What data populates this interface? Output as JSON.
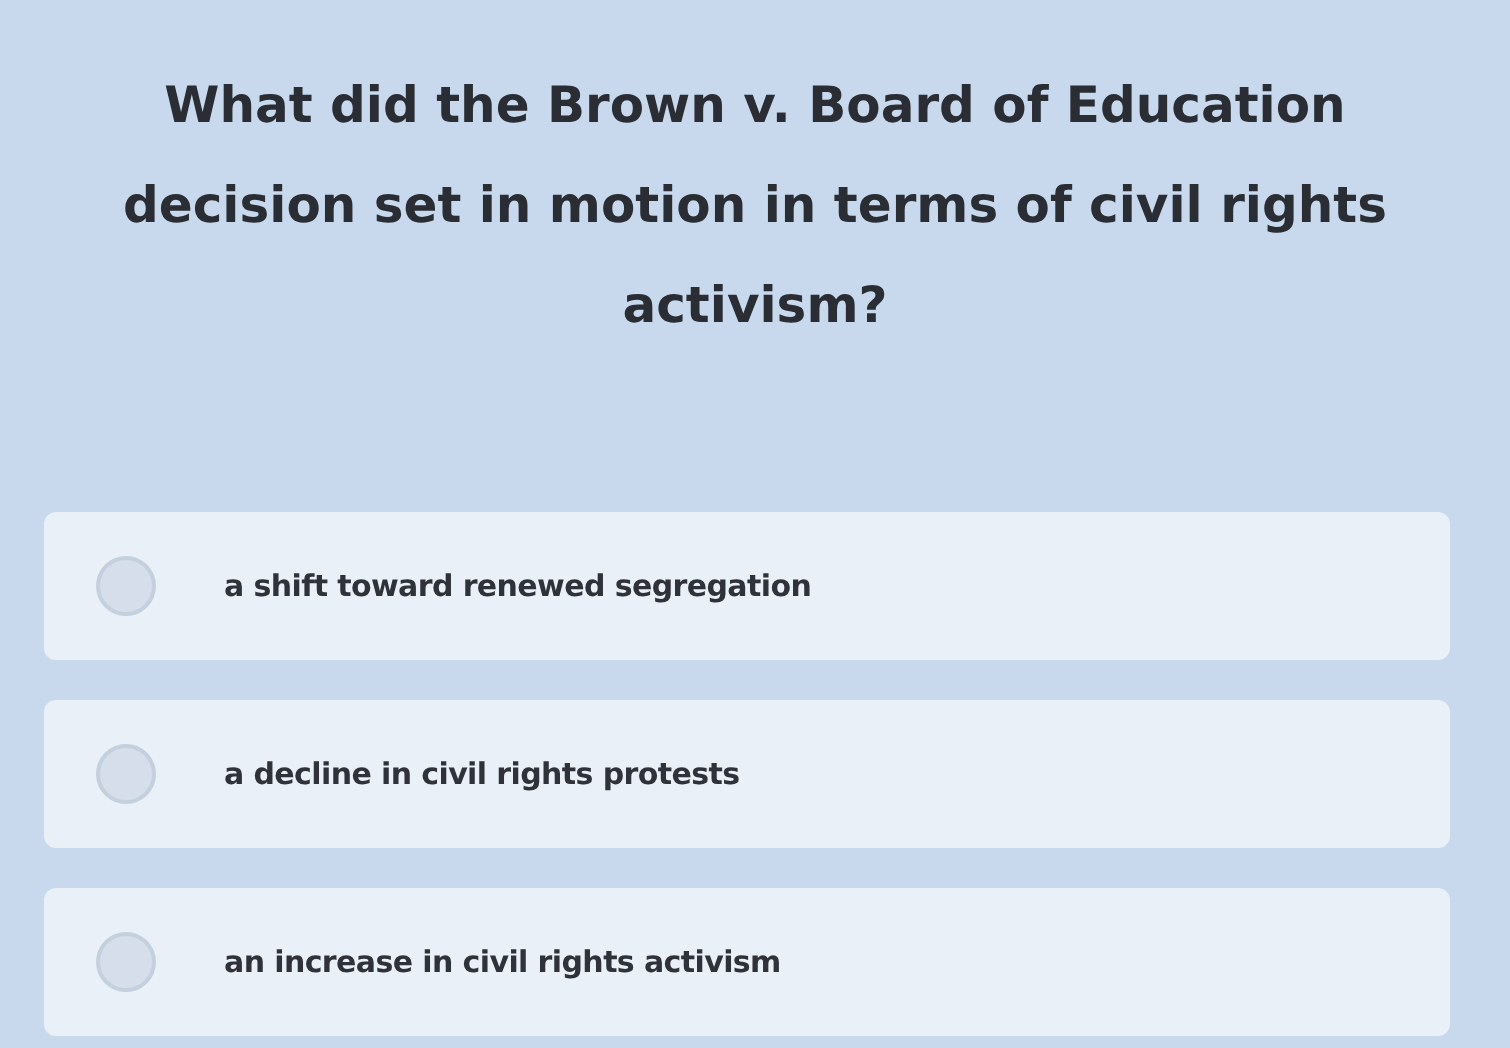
{
  "question": "What did the Brown v. Board of Education decision set in motion in terms of civil rights activism?",
  "options": [
    {
      "label": "a shift toward renewed segregation",
      "selected": false
    },
    {
      "label": "a decline in civil rights protests",
      "selected": false
    },
    {
      "label": "an increase in civil rights activism",
      "selected": false
    }
  ]
}
